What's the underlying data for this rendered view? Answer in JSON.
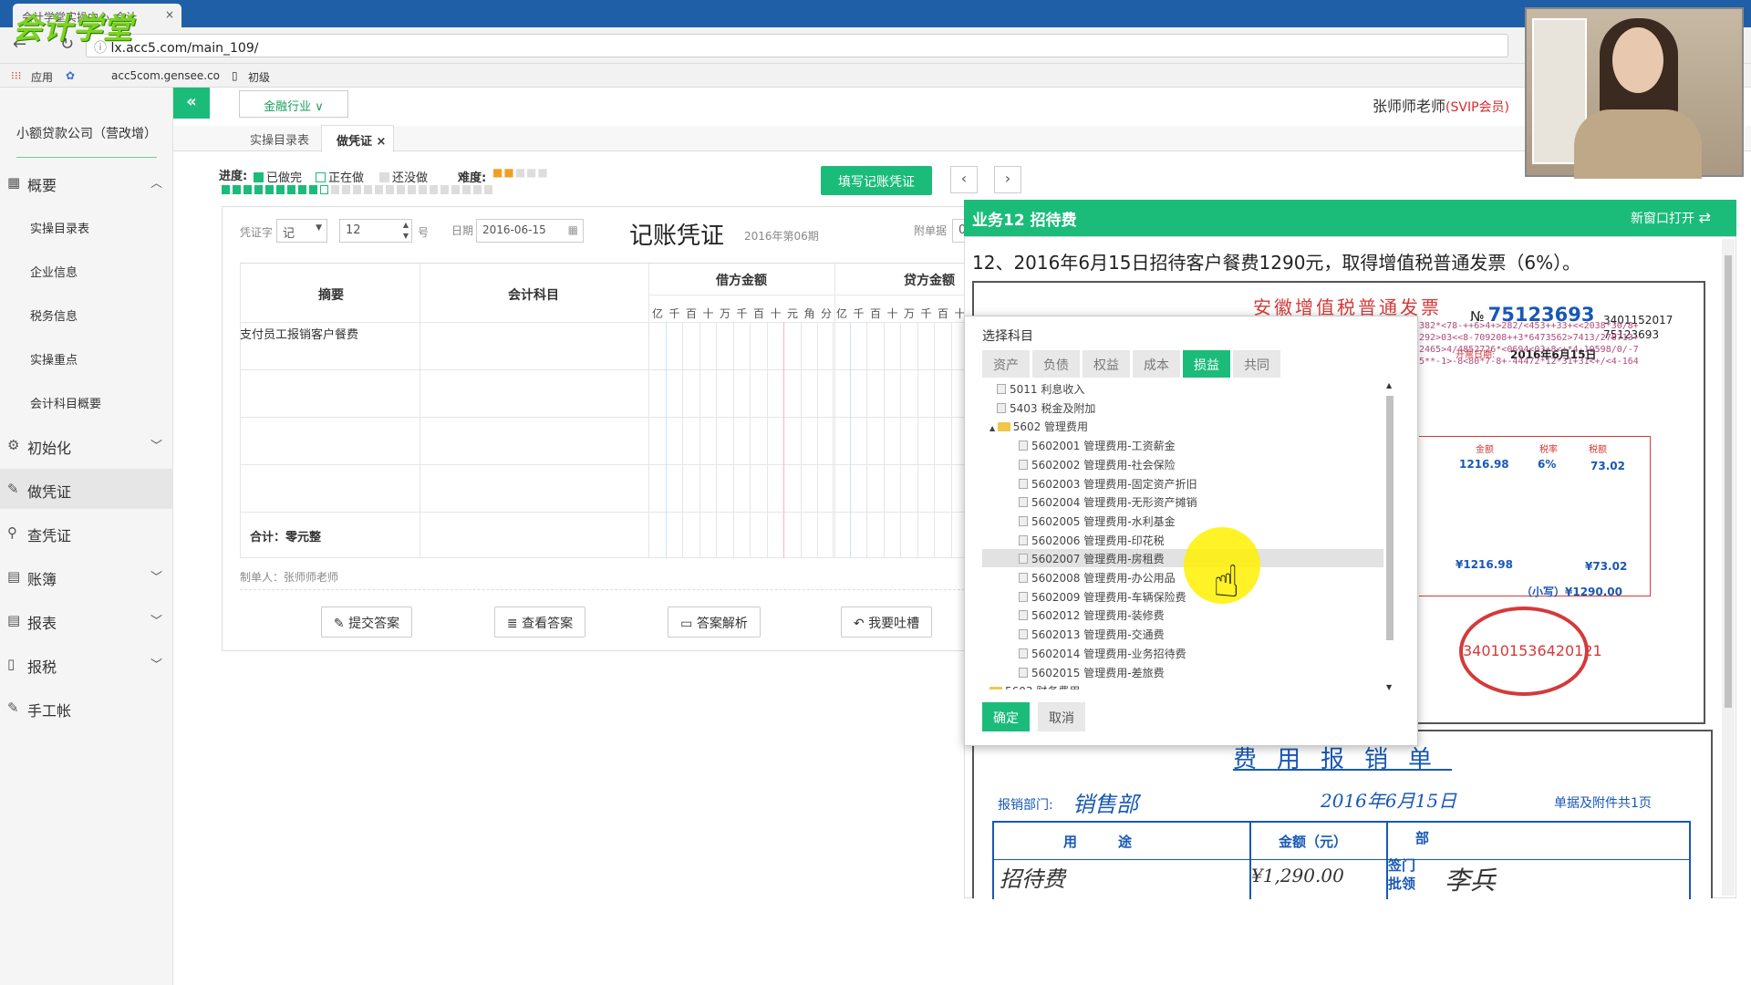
{
  "browser": {
    "tab_title": "会计学堂实操中心_会计",
    "tab_close": "×",
    "url": "lx.acc5.com/main_109/",
    "logo_text": "会计学堂",
    "bookmarks": [
      "应用",
      "acc5com.gensee.co",
      "初级"
    ]
  },
  "sidebar": {
    "company": "小额贷款公司（营改增）",
    "items": [
      {
        "label": "概要",
        "icon": "overview-icon",
        "expanded": true
      },
      {
        "label": "初始化",
        "icon": "gear-icon"
      },
      {
        "label": "做凭证",
        "icon": "pen-icon",
        "active": true
      },
      {
        "label": "查凭证",
        "icon": "search-icon"
      },
      {
        "label": "账簿",
        "icon": "ledger-icon"
      },
      {
        "label": "报表",
        "icon": "report-icon"
      },
      {
        "label": "报税",
        "icon": "document-icon"
      },
      {
        "label": "手工帐",
        "icon": "pen-icon"
      }
    ],
    "sub_items": [
      "实操目录表",
      "企业信息",
      "税务信息",
      "实操重点",
      "会计科目概要"
    ]
  },
  "topbar": {
    "collapse": "«",
    "industry": "金融行业 ∨",
    "teacher": "张师师老师",
    "vip": "(SVIP会员)"
  },
  "tabs": [
    {
      "label": "实操目录表"
    },
    {
      "label": "做凭证",
      "close": "×",
      "active": true
    }
  ],
  "progress": {
    "label": "进度:",
    "legend_done": "已做完",
    "legend_doing": "正在做",
    "legend_todo": "还没做",
    "difficulty_label": "难度:",
    "difficulty_stars": 2,
    "difficulty_max": 5,
    "done_count": 9,
    "current_index": 10,
    "total_count": 25,
    "fill_button": "填写记账凭证",
    "prev": "‹",
    "next": "›"
  },
  "voucher": {
    "type_label": "凭证字",
    "type_value": "记",
    "number_value": "12",
    "number_suffix": "号",
    "date_label": "日期",
    "date_value": "2016-06-15",
    "title": "记账凭证",
    "period": "2016年第06期",
    "attach_label": "附单据",
    "attach_value": "0",
    "headers": {
      "summary": "摘要",
      "account": "会计科目",
      "debit": "借方金额",
      "credit": "贷方金额"
    },
    "digits": [
      "亿",
      "千",
      "百",
      "十",
      "万",
      "千",
      "百",
      "十",
      "元",
      "角",
      "分"
    ],
    "rows": [
      {
        "summary": "支付员工报销客户餐费"
      },
      {
        "summary": ""
      },
      {
        "summary": ""
      },
      {
        "summary": ""
      }
    ],
    "total": "合计：零元整",
    "maker": "制单人：张师师老师"
  },
  "actions": [
    {
      "label": "提交答案",
      "icon": "edit-icon"
    },
    {
      "label": "查看答案",
      "icon": "database-icon"
    },
    {
      "label": "答案解析",
      "icon": "folder-icon"
    },
    {
      "label": "我要吐槽",
      "icon": "reply-icon"
    }
  ],
  "business": {
    "title": "业务12 招待费",
    "new_window": "新窗口打开",
    "question": "12、2016年6月15日招待客户餐费1290元，取得增值税普通发票（6%）。"
  },
  "invoice": {
    "title": "安徽增值税普通发票",
    "no_prefix": "№",
    "number": "75123693",
    "code1": "3401152017",
    "code2": "75123693",
    "date_label": "开票日期:",
    "date": "2016年6月15日",
    "cipher": "382*<78-++6>4+>282/<453++33+<<2038*30/8+>2/\n292>03<<8-709208++3*6473562>7413/278713+\n2465>4/4852726*<0694<03+8<+*4-19598/0/-7090\n5**-1>-8<80*7-8+-44472*12*31+31<+/<4-164>7",
    "col_amount": "金额",
    "col_rate": "税率",
    "col_tax": "税额",
    "amount": "1216.98",
    "rate": "6%",
    "tax": "73.02",
    "amount_total": "¥1216.98",
    "tax_total": "¥73.02",
    "grand_total": "（小写）¥1290.00",
    "stamp_text": "340101536420121"
  },
  "expense": {
    "title": "费用报销单",
    "dept_label": "报销部门:",
    "dept": "销售部",
    "date": "2016年6月15日",
    "attach": "单据及附件共1页",
    "col_use": "用　　　途",
    "col_amount": "金额（元）",
    "col_dept": "部",
    "col_sign": "签门",
    "col_approve": "批领",
    "use": "招待费",
    "amount": "¥1,290.00",
    "signer": "李兵"
  },
  "dialog": {
    "title": "选择科目",
    "categories": [
      {
        "label": "资产"
      },
      {
        "label": "负债"
      },
      {
        "label": "权益"
      },
      {
        "label": "成本"
      },
      {
        "label": "损益",
        "active": true
      },
      {
        "label": "共同"
      }
    ],
    "tree": [
      {
        "label": "5011 利息收入",
        "level": 1
      },
      {
        "label": "5403 税金及附加",
        "level": 1
      },
      {
        "label": "5602 管理费用",
        "level": 0,
        "folder": true,
        "toggle": "▲"
      },
      {
        "label": "5602001 管理费用-工资薪金",
        "level": 2
      },
      {
        "label": "5602002 管理费用-社会保险",
        "level": 2
      },
      {
        "label": "5602003 管理费用-固定资产折旧",
        "level": 2
      },
      {
        "label": "5602004 管理费用-无形资产摊销",
        "level": 2
      },
      {
        "label": "5602005 管理费用-水利基金",
        "level": 2
      },
      {
        "label": "5602006 管理费用-印花税",
        "level": 2
      },
      {
        "label": "5602007 管理费用-房租费",
        "level": 2,
        "selected": true
      },
      {
        "label": "5602008 管理费用-办公用品",
        "level": 2
      },
      {
        "label": "5602009 管理费用-车辆保险费",
        "level": 2
      },
      {
        "label": "5602012 管理费用-装修费",
        "level": 2
      },
      {
        "label": "5602013 管理费用-交通费",
        "level": 2
      },
      {
        "label": "5602014 管理费用-业务招待费",
        "level": 2
      },
      {
        "label": "5602015 管理费用-差旅费",
        "level": 2
      },
      {
        "label": "5603 财务费用",
        "level": 0,
        "folder": true
      }
    ],
    "ok": "确定",
    "cancel": "取消"
  },
  "colors": {
    "accent": "#1bbc7a",
    "vip": "#d62b2b",
    "invoice_blue": "#1858b5",
    "invoice_red": "#d43a3a"
  }
}
